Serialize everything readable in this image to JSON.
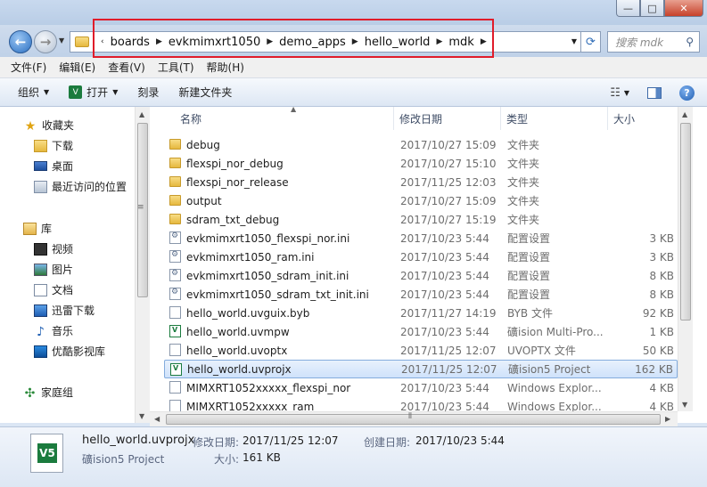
{
  "window": {
    "minimize_label": "—",
    "maximize_label": "□",
    "close_label": "✕"
  },
  "nav": {
    "back_glyph": "←",
    "forward_glyph": "→"
  },
  "address": {
    "crumbs": [
      "boards",
      "evkmimxrt1050",
      "demo_apps",
      "hello_world",
      "mdk"
    ]
  },
  "search": {
    "placeholder": "搜索 mdk"
  },
  "menu": [
    "文件(F)",
    "编辑(E)",
    "查看(V)",
    "工具(T)",
    "帮助(H)"
  ],
  "toolbar": {
    "organize": "组织",
    "open": "打开",
    "burn": "刻录",
    "new_folder": "新建文件夹",
    "help": "?"
  },
  "sidebar": {
    "favorites": {
      "label": "收藏夹",
      "items": [
        "下载",
        "桌面",
        "最近访问的位置"
      ]
    },
    "libraries": {
      "label": "库",
      "items": [
        "视频",
        "图片",
        "文档",
        "迅雷下载",
        "音乐",
        "优酷影视库"
      ]
    },
    "homegroup": "家庭组"
  },
  "columns": {
    "name": "名称",
    "date": "修改日期",
    "type": "类型",
    "size": "大小"
  },
  "files": [
    {
      "name": "debug",
      "date": "2017/10/27 15:09",
      "type": "文件夹",
      "size": "",
      "icon": "folder"
    },
    {
      "name": "flexspi_nor_debug",
      "date": "2017/10/27 15:10",
      "type": "文件夹",
      "size": "",
      "icon": "folder"
    },
    {
      "name": "flexspi_nor_release",
      "date": "2017/11/25 12:03",
      "type": "文件夹",
      "size": "",
      "icon": "folder"
    },
    {
      "name": "output",
      "date": "2017/10/27 15:09",
      "type": "文件夹",
      "size": "",
      "icon": "folder"
    },
    {
      "name": "sdram_txt_debug",
      "date": "2017/10/27 15:19",
      "type": "文件夹",
      "size": "",
      "icon": "folder"
    },
    {
      "name": "evkmimxrt1050_flexspi_nor.ini",
      "date": "2017/10/23 5:44",
      "type": "配置设置",
      "size": "3 KB",
      "icon": "ini"
    },
    {
      "name": "evkmimxrt1050_ram.ini",
      "date": "2017/10/23 5:44",
      "type": "配置设置",
      "size": "3 KB",
      "icon": "ini"
    },
    {
      "name": "evkmimxrt1050_sdram_init.ini",
      "date": "2017/10/23 5:44",
      "type": "配置设置",
      "size": "8 KB",
      "icon": "ini"
    },
    {
      "name": "evkmimxrt1050_sdram_txt_init.ini",
      "date": "2017/10/23 5:44",
      "type": "配置设置",
      "size": "8 KB",
      "icon": "ini"
    },
    {
      "name": "hello_world.uvguix.byb",
      "date": "2017/11/27 14:19",
      "type": "BYB 文件",
      "size": "92 KB",
      "icon": "plain"
    },
    {
      "name": "hello_world.uvmpw",
      "date": "2017/10/23 5:44",
      "type": "礦ision Multi-Pro...",
      "size": "1 KB",
      "icon": "uv"
    },
    {
      "name": "hello_world.uvoptx",
      "date": "2017/11/25 12:07",
      "type": "UVOPTX 文件",
      "size": "50 KB",
      "icon": "plain"
    },
    {
      "name": "hello_world.uvprojx",
      "date": "2017/11/25 12:07",
      "type": "礦ision5 Project",
      "size": "162 KB",
      "icon": "uv"
    },
    {
      "name": "MIMXRT1052xxxxx_flexspi_nor",
      "date": "2017/10/23 5:44",
      "type": "Windows Explor...",
      "size": "4 KB",
      "icon": "plain"
    },
    {
      "name": "MIMXRT1052xxxxx_ram",
      "date": "2017/10/23 5:44",
      "type": "Windows Explor...",
      "size": "4 KB",
      "icon": "plain"
    }
  ],
  "selected_index": 12,
  "details": {
    "filename": "hello_world.uvprojx",
    "modified_label": "修改日期:",
    "modified_value": "2017/11/25 12:07",
    "created_label": "创建日期:",
    "created_value": "2017/10/23 5:44",
    "type": "礦ision5 Project",
    "size_label": "大小:",
    "size_value": "161 KB",
    "icon_text": "V5"
  },
  "colors": {
    "highlight_box": "#e01c2a",
    "selection": "#cfe2fb",
    "uv_green": "#1b7b3e"
  }
}
